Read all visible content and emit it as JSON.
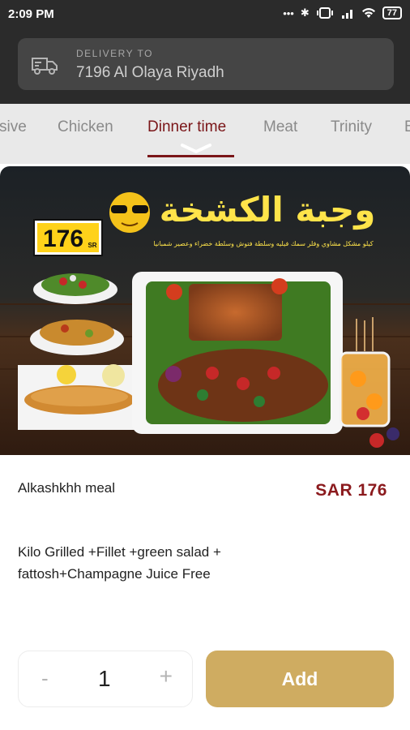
{
  "status_bar": {
    "time": "2:09 PM",
    "dots": "•••",
    "bluetooth": "✱",
    "battery": "77"
  },
  "delivery": {
    "label": "DELIVERY TO",
    "address": "7196 Al Olaya Riyadh"
  },
  "tabs": [
    {
      "label": "sive",
      "active": false
    },
    {
      "label": "Chicken",
      "active": false
    },
    {
      "label": "Dinner time",
      "active": true
    },
    {
      "label": "Meat",
      "active": false
    },
    {
      "label": "Trinity",
      "active": false
    },
    {
      "label": "B",
      "active": false
    }
  ],
  "promo_image": {
    "arabic_title": "وجبة الكشخة",
    "price_badge": "176",
    "price_unit": "SR",
    "arabic_subtitle": "كيلو مشكل مشاوي وفلر سمك فيليه وسلطة فتوش وسلطة خضراء وعصير شمبانيا"
  },
  "item": {
    "name": "Alkashkhh meal",
    "price": "SAR 176",
    "description": "Kilo Grilled  +Fillet +green salad + fattosh+Champagne Juice Free"
  },
  "stepper": {
    "minus": "-",
    "value": "1",
    "plus": "+"
  },
  "add_button": {
    "label": "Add",
    "color": "#cfac61"
  },
  "colors": {
    "accent": "#7a1518",
    "price": "#8b1a1d",
    "header_bg": "#2b2b2b"
  }
}
